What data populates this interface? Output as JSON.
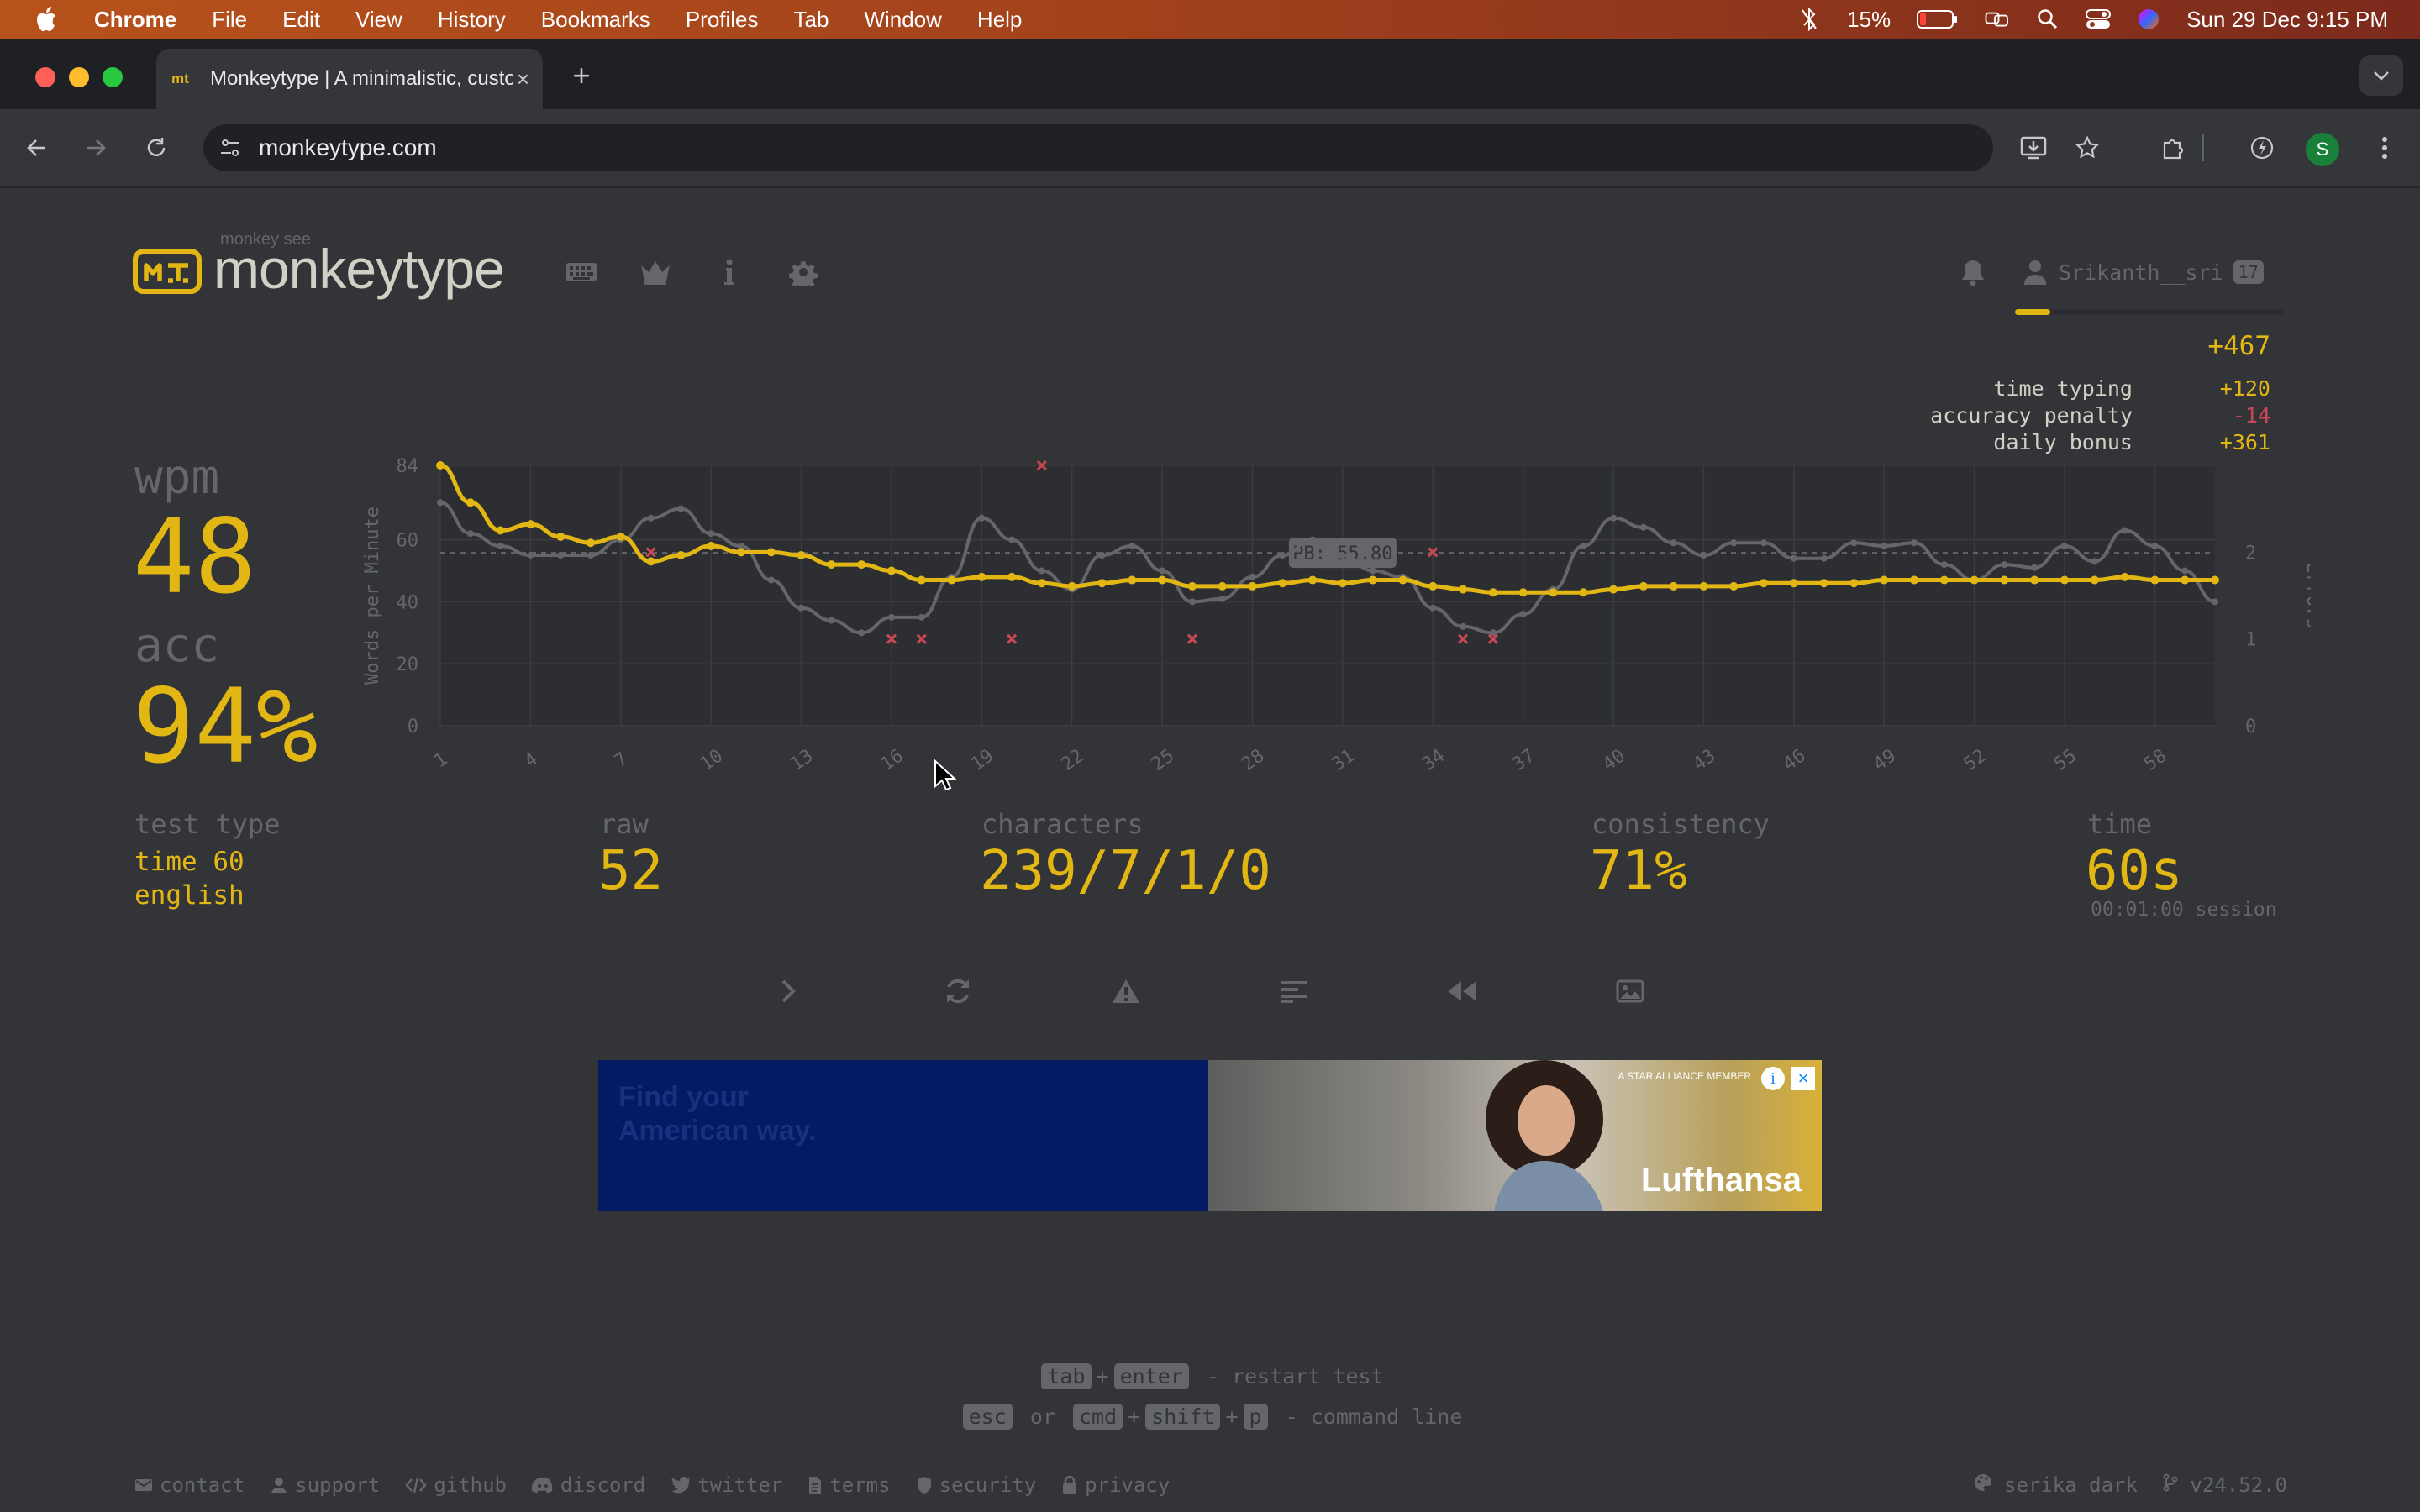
{
  "menubar": {
    "items": [
      "Chrome",
      "File",
      "Edit",
      "View",
      "History",
      "Bookmarks",
      "Profiles",
      "Tab",
      "Window",
      "Help"
    ],
    "battery": "15%",
    "datetime": "Sun 29 Dec  9:15 PM"
  },
  "browser": {
    "tab_title": "Monkeytype | A minimalistic, customizable typing test",
    "favicon_text": "mt",
    "url": "monkeytype.com",
    "profile_initial": "S"
  },
  "header": {
    "logo_top": "monkey see",
    "logo_text": "monkeytype",
    "username": "Srikanth__sri",
    "level": "17",
    "xp_progress": 0.13
  },
  "xp": {
    "total": "+467",
    "rows": [
      {
        "label": "time typing",
        "value": "+120",
        "color": "#e2b714"
      },
      {
        "label": "accuracy penalty",
        "value": "-14",
        "color": "#ca4754"
      },
      {
        "label": "daily bonus",
        "value": "+361",
        "color": "#e2b714"
      }
    ]
  },
  "result": {
    "wpm_label": "wpm",
    "wpm": "48",
    "acc_label": "acc",
    "acc": "94%",
    "test_type_label": "test type",
    "test_type_line1": "time 60",
    "test_type_line2": "english",
    "raw_label": "raw",
    "raw": "52",
    "characters_label": "characters",
    "characters": "239/7/1/0",
    "consistency_label": "consistency",
    "consistency": "71%",
    "time_label": "time",
    "time": "60s",
    "session": "00:01:00 session"
  },
  "chart_data": {
    "type": "line",
    "ylabel": "Words per Minute",
    "y2label": "Errors",
    "ylim": [
      0,
      84
    ],
    "y_ticks": [
      0,
      20,
      40,
      60,
      84
    ],
    "y2_ticks": [
      0,
      1,
      2
    ],
    "x_ticks": [
      "1",
      "4",
      "7",
      "10",
      "13",
      "16",
      "19",
      "22",
      "25",
      "28",
      "31",
      "34",
      "37",
      "40",
      "43",
      "46",
      "49",
      "52",
      "55",
      "58"
    ],
    "pb_label": "PB: 55.80",
    "pb_value": 55.8,
    "grid": true,
    "x": [
      1,
      2,
      3,
      4,
      5,
      6,
      7,
      8,
      9,
      10,
      11,
      12,
      13,
      14,
      15,
      16,
      17,
      18,
      19,
      20,
      21,
      22,
      23,
      24,
      25,
      26,
      27,
      28,
      29,
      30,
      31,
      32,
      33,
      34,
      35,
      36,
      37,
      38,
      39,
      40,
      41,
      42,
      43,
      44,
      45,
      46,
      47,
      48,
      49,
      50,
      51,
      52,
      53,
      54,
      55,
      56,
      57,
      58,
      59,
      60
    ],
    "series": [
      {
        "name": "wpm",
        "color": "#e2b714",
        "values": [
          84,
          72,
          63,
          65,
          61,
          59,
          61,
          53,
          55,
          58,
          56,
          56,
          55,
          52,
          52,
          50,
          47,
          47,
          48,
          48,
          46,
          45,
          46,
          47,
          47,
          45,
          45,
          45,
          46,
          47,
          46,
          47,
          47,
          45,
          44,
          43,
          43,
          43,
          43,
          44,
          45,
          45,
          45,
          45,
          46,
          46,
          46,
          46,
          47,
          47,
          47,
          47,
          47,
          47,
          47,
          47,
          48,
          47,
          47,
          47
        ]
      },
      {
        "name": "raw",
        "color": "#646669",
        "values": [
          72,
          62,
          58,
          55,
          55,
          55,
          60,
          67,
          70,
          62,
          58,
          47,
          38,
          34,
          30,
          35,
          35,
          48,
          67,
          60,
          50,
          44,
          55,
          58,
          50,
          40,
          41,
          48,
          55,
          60,
          55,
          50,
          48,
          38,
          32,
          30,
          36,
          44,
          58,
          67,
          64,
          59,
          55,
          59,
          59,
          54,
          54,
          59,
          58,
          59,
          52,
          47,
          52,
          51,
          58,
          53,
          63,
          58,
          50,
          40
        ]
      },
      {
        "name": "errors",
        "color": "#ca4754",
        "points": [
          [
            8,
            2
          ],
          [
            16,
            1
          ],
          [
            17,
            1
          ],
          [
            20,
            1
          ],
          [
            21,
            3
          ],
          [
            26,
            1
          ],
          [
            34,
            2
          ],
          [
            35,
            1
          ],
          [
            36,
            1
          ]
        ]
      }
    ]
  },
  "actions": [
    "next-test",
    "restart",
    "report",
    "words-history",
    "replay",
    "screenshot"
  ],
  "ad": {
    "headline_line1": "Find your",
    "headline_line2": "American way.",
    "brand": "Lufthansa",
    "member": "A STAR ALLIANCE MEMBER"
  },
  "hints": {
    "line1_keys": [
      "tab",
      "enter"
    ],
    "line1_text": "- restart test",
    "line2_keys": [
      "esc",
      "cmd",
      "shift",
      "p"
    ],
    "line2_or": "or",
    "line2_text": "- command line"
  },
  "footer": {
    "links": [
      "contact",
      "support",
      "github",
      "discord",
      "twitter",
      "terms",
      "security",
      "privacy"
    ],
    "theme": "serika dark",
    "version": "v24.52.0"
  }
}
